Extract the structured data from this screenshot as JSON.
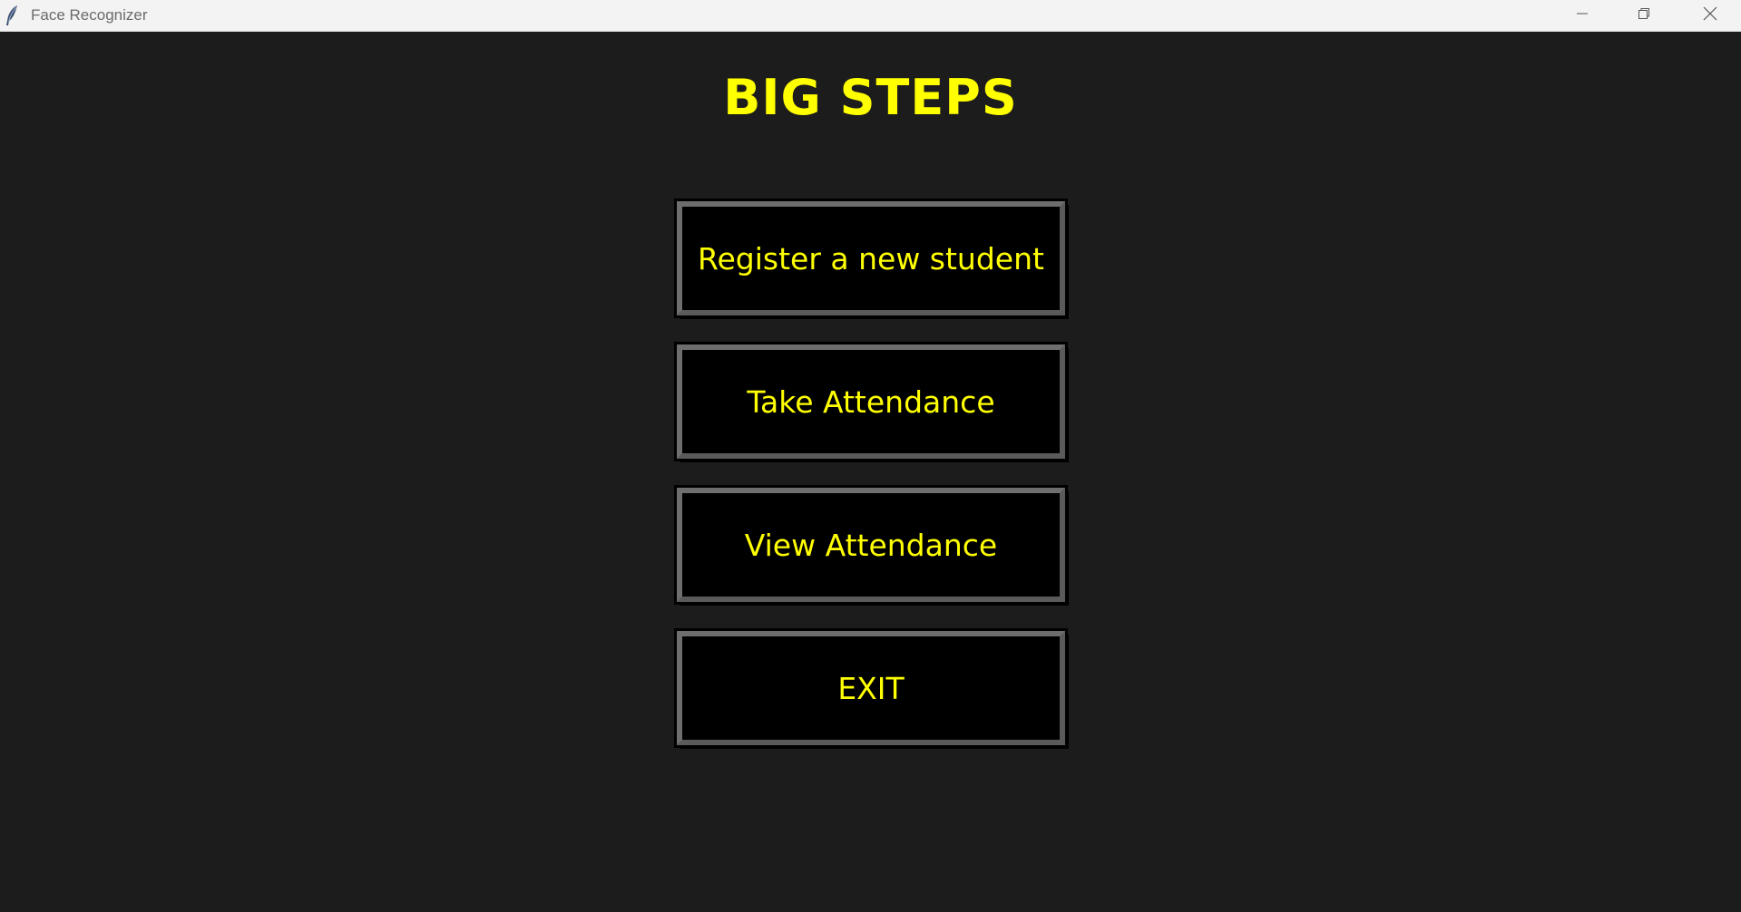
{
  "window": {
    "title": "Face Recognizer",
    "app_icon": "feather-icon",
    "controls": {
      "minimize_icon": "minimize-icon",
      "maximize_icon": "restore-icon",
      "close_icon": "close-icon"
    }
  },
  "main": {
    "heading": "BIG STEPS",
    "buttons": {
      "register": "Register a new student",
      "take_attendance": "Take Attendance",
      "view_attendance": "View Attendance",
      "exit": "EXIT"
    }
  },
  "colors": {
    "background": "#1c1c1c",
    "accent_text": "#ffff00",
    "button_bg": "#000000",
    "button_border": "#6e6e6e",
    "titlebar_bg": "#f3f3f3"
  }
}
